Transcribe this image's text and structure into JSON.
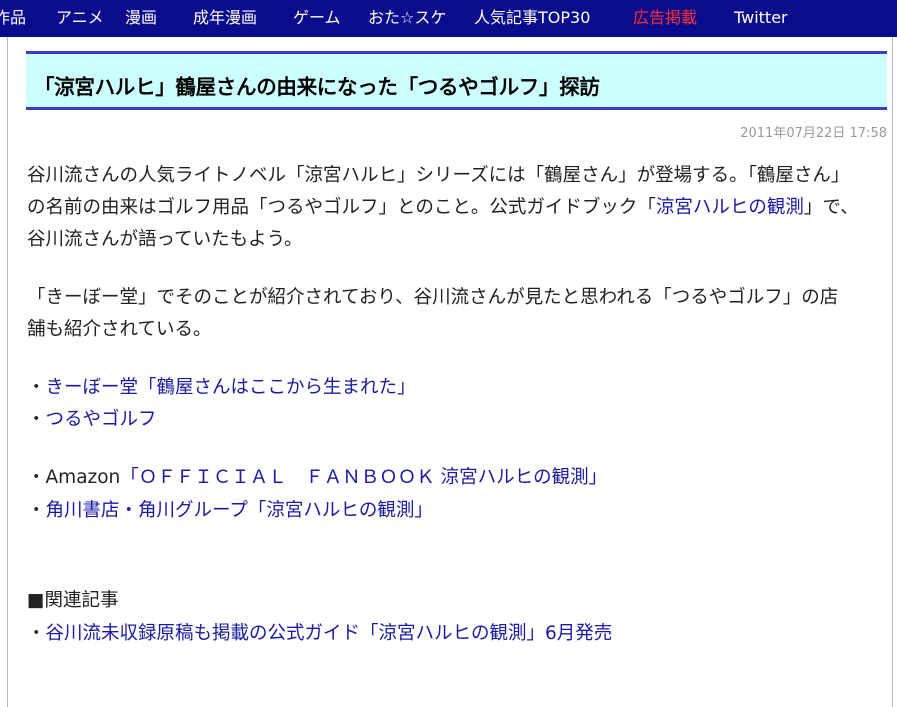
{
  "nav": {
    "items": [
      "作品",
      "アニメ",
      "漫画",
      "成年漫画",
      "ゲーム",
      "おた☆スケ",
      "人気記事TOP30",
      "広告掲載",
      "Twitter"
    ]
  },
  "article": {
    "title": "「涼宮ハルヒ」鶴屋さんの由来になった「つるやゴルフ」探訪",
    "date": "2011年07月22日 17:58",
    "p1_l1": "谷川流さんの人気ライトノベル「涼宮ハルヒ」シリーズには「鶴屋さん」が登場する。「鶴屋さん」",
    "p1_l2a": "の名前の由来はゴルフ用品「つるやゴルフ」とのこと。公式ガイドブック「",
    "p1_l2_link": "涼宮ハルヒの観測",
    "p1_l2b": "」で、",
    "p1_l3": "谷川流さんが語っていたもよう。",
    "p2_l1": "「きーぼー堂」でそのことが紹介されており、谷川流さんが見たと思われる「つるやゴルフ」の店",
    "p2_l2": "舗も紹介されている。",
    "bullet": "・",
    "links1": [
      "きーぼー堂「鶴屋さんはここから生まれた」",
      "つるやゴルフ"
    ],
    "amazon_prefix": "Amazon",
    "amazon_link": "「ＯＦＦＩＣＩＡＬ　ＦＡＮＢＯＯＫ 涼宮ハルヒの観測」",
    "kadokawa_link": "角川書店・角川グループ「涼宮ハルヒの観測」",
    "related_heading": "■関連記事",
    "related_link": "谷川流未収録原稿も掲載の公式ガイド「涼宮ハルヒの観測」6月発売"
  }
}
